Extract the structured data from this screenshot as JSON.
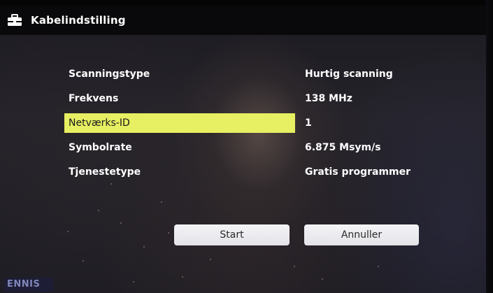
{
  "header": {
    "title": "Kabelindstilling",
    "icon": "toolbox-icon"
  },
  "settings": [
    {
      "label": "Scanningstype",
      "value": "Hurtig scanning",
      "selected": false
    },
    {
      "label": "Frekvens",
      "value": "138 MHz",
      "selected": false
    },
    {
      "label": "Netværks-ID",
      "value": "1",
      "selected": true
    },
    {
      "label": "Symbolrate",
      "value": "6.875 Msym/s",
      "selected": false
    },
    {
      "label": "Tjenestetype",
      "value": "Gratis programmer",
      "selected": false
    }
  ],
  "buttons": {
    "start_label": "Start",
    "cancel_label": "Annuller"
  },
  "background_logo": "ENNIS",
  "colors": {
    "highlight": "#e7ef62",
    "title_bar": "#08080a",
    "button": "#eeeef2"
  }
}
